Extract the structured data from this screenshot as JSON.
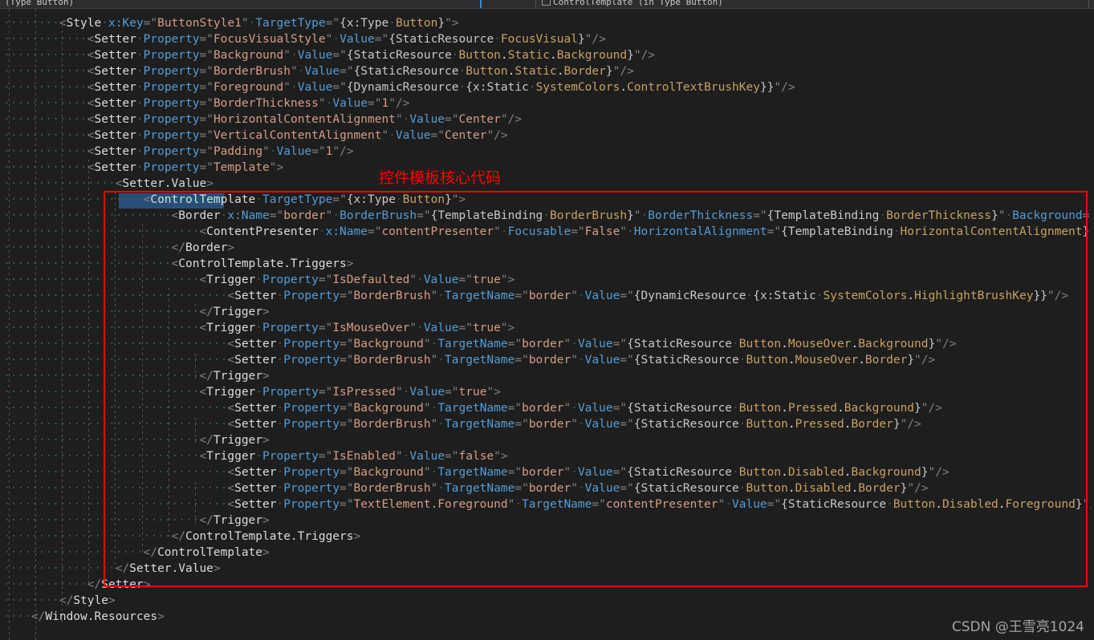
{
  "toolbar": {
    "left_label": "(Type Button)",
    "right_label": "ControlTemplate (in Type Button)",
    "right_icon": "template-icon",
    "divider": "pane-splitter"
  },
  "annotation": {
    "note_text": "控件模板核心代码",
    "note_color": "#ff0000",
    "box_color": "#ff0000"
  },
  "selection": {
    "text": "ControlTemplate",
    "highlight_color": "#264f78"
  },
  "watermark": {
    "text": "CSDN @王雪亮1024"
  },
  "editor": {
    "language": "XAML",
    "theme": "dark",
    "background": "#1e1e1e",
    "lines": [
      "        <Style x:Key=\"ButtonStyle1\" TargetType=\"{x:Type Button}\">",
      "            <Setter Property=\"FocusVisualStyle\" Value=\"{StaticResource FocusVisual}\"/>",
      "            <Setter Property=\"Background\" Value=\"{StaticResource Button.Static.Background}\"/>",
      "            <Setter Property=\"BorderBrush\" Value=\"{StaticResource Button.Static.Border}\"/>",
      "            <Setter Property=\"Foreground\" Value=\"{DynamicResource {x:Static SystemColors.ControlTextBrushKey}}\"/>",
      "            <Setter Property=\"BorderThickness\" Value=\"1\"/>",
      "            <Setter Property=\"HorizontalContentAlignment\" Value=\"Center\"/>",
      "            <Setter Property=\"VerticalContentAlignment\" Value=\"Center\"/>",
      "            <Setter Property=\"Padding\" Value=\"1\"/>",
      "            <Setter Property=\"Template\">",
      "                <Setter.Value>",
      "                    <ControlTemplate TargetType=\"{x:Type Button}\">",
      "                        <Border x:Name=\"border\" BorderBrush=\"{TemplateBinding BorderBrush}\" BorderThickness=\"{TemplateBinding BorderThickness}\" Background=\"{Templa",
      "                            <ContentPresenter x:Name=\"contentPresenter\" Focusable=\"False\" HorizontalAlignment=\"{TemplateBinding HorizontalContentAlignment}\" Margi",
      "                        </Border>",
      "                        <ControlTemplate.Triggers>",
      "                            <Trigger Property=\"IsDefaulted\" Value=\"true\">",
      "                                <Setter Property=\"BorderBrush\" TargetName=\"border\" Value=\"{DynamicResource {x:Static SystemColors.HighlightBrushKey}}\"/>",
      "                            </Trigger>",
      "                            <Trigger Property=\"IsMouseOver\" Value=\"true\">",
      "                                <Setter Property=\"Background\" TargetName=\"border\" Value=\"{StaticResource Button.MouseOver.Background}\"/>",
      "                                <Setter Property=\"BorderBrush\" TargetName=\"border\" Value=\"{StaticResource Button.MouseOver.Border}\"/>",
      "                            </Trigger>",
      "                            <Trigger Property=\"IsPressed\" Value=\"true\">",
      "                                <Setter Property=\"Background\" TargetName=\"border\" Value=\"{StaticResource Button.Pressed.Background}\"/>",
      "                                <Setter Property=\"BorderBrush\" TargetName=\"border\" Value=\"{StaticResource Button.Pressed.Border}\"/>",
      "                            </Trigger>",
      "                            <Trigger Property=\"IsEnabled\" Value=\"false\">",
      "                                <Setter Property=\"Background\" TargetName=\"border\" Value=\"{StaticResource Button.Disabled.Background}\"/>",
      "                                <Setter Property=\"BorderBrush\" TargetName=\"border\" Value=\"{StaticResource Button.Disabled.Border}\"/>",
      "                                <Setter Property=\"TextElement.Foreground\" TargetName=\"contentPresenter\" Value=\"{StaticResource Button.Disabled.Foreground}\"/>",
      "                            </Trigger>",
      "                        </ControlTemplate.Triggers>",
      "                    </ControlTemplate>",
      "                </Setter.Value>",
      "            </Setter>",
      "        </Style>",
      "    </Window.Resources>"
    ]
  }
}
